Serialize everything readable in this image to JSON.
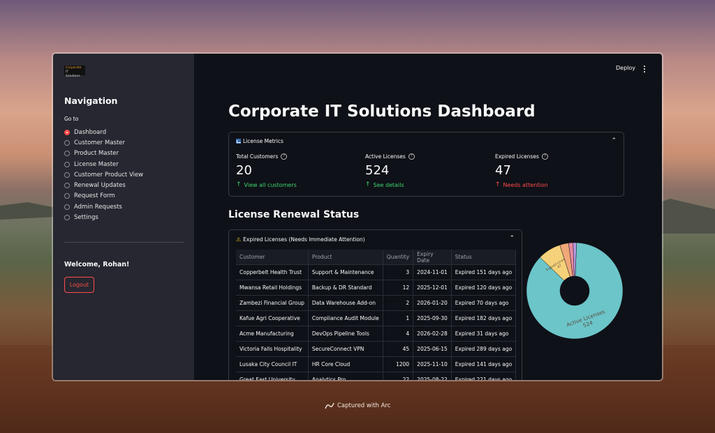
{
  "app": {
    "logo_line1": "Corporate",
    "logo_line2": "IT Solutions",
    "deploy_label": "Deploy"
  },
  "sidebar": {
    "title": "Navigation",
    "goto_label": "Go to",
    "items": [
      {
        "label": "Dashboard",
        "selected": true
      },
      {
        "label": "Customer Master",
        "selected": false
      },
      {
        "label": "Product Master",
        "selected": false
      },
      {
        "label": "License Master",
        "selected": false
      },
      {
        "label": "Customer Product View",
        "selected": false
      },
      {
        "label": "Renewal Updates",
        "selected": false
      },
      {
        "label": "Request Form",
        "selected": false
      },
      {
        "label": "Admin Requests",
        "selected": false
      },
      {
        "label": "Settings",
        "selected": false
      }
    ],
    "welcome": "Welcome, Rohan!",
    "logout_label": "Logout"
  },
  "main": {
    "title": "Corporate IT Solutions Dashboard",
    "metrics_header": "License Metrics",
    "metrics": [
      {
        "label": "Total Customers",
        "value": "20",
        "delta": "View all customers",
        "direction": "up",
        "color": "#3dd56d"
      },
      {
        "label": "Active Licenses",
        "value": "524",
        "delta": "See details",
        "direction": "up",
        "color": "#3dd56d"
      },
      {
        "label": "Expired Licenses",
        "value": "47",
        "delta": "Needs attention",
        "direction": "up",
        "color": "#ff4b4b"
      }
    ],
    "renewal_title": "License Renewal Status",
    "expired_header": "Expired Licenses (Needs Immediate Attention)",
    "table": {
      "columns": [
        "Customer",
        "Product",
        "Quantity",
        "Expiry Date",
        "Status"
      ],
      "rows": [
        [
          "Copperbelt Health Trust",
          "Support & Maintenance",
          "3",
          "2024-11-01",
          "Expired 151 days ago"
        ],
        [
          "Mwansa Retail Holdings",
          "Backup & DR Standard",
          "12",
          "2025-12-01",
          "Expired 120 days ago"
        ],
        [
          "Zambezi Financial Group",
          "Data Warehouse Add-on",
          "2",
          "2026-01-20",
          "Expired 70 days ago"
        ],
        [
          "Kafue Agri Cooperative",
          "Compliance Audit Module",
          "1",
          "2025-09-30",
          "Expired 182 days ago"
        ],
        [
          "Acme Manufacturing",
          "DevOps Pipeline Tools",
          "4",
          "2026-02-28",
          "Expired 31 days ago"
        ],
        [
          "Victoria Falls Hospitality",
          "SecureConnect VPN",
          "45",
          "2025-06-15",
          "Expired 289 days ago"
        ],
        [
          "Lusaka City Council IT",
          "HR Core Cloud",
          "1200",
          "2025-11-10",
          "Expired 141 days ago"
        ],
        [
          "Great East University",
          "Analytics Pro",
          "22",
          "2025-08-22",
          "Expired 221 days ago"
        ]
      ]
    }
  },
  "chart_data": {
    "type": "pie",
    "donut": true,
    "slices": [
      {
        "label": "Active Licenses",
        "value": 524,
        "color": "#6cc5c9",
        "label_text": "Active Licenses\n524"
      },
      {
        "label": "Expired Licenses",
        "value": 47,
        "color": "#f5d27a",
        "label_text": "Expired Licenses\n47"
      },
      {
        "label": "",
        "value": 18,
        "color": "#f0a878",
        "label_text": ""
      },
      {
        "label": "",
        "value": 9,
        "color": "#e88aa0",
        "label_text": ""
      },
      {
        "label": "",
        "value": 7,
        "color": "#b79ae0",
        "label_text": ""
      }
    ]
  },
  "footer": {
    "captured": "Captured with Arc"
  },
  "colors": {
    "accent": "#ff4b4b",
    "positive": "#3dd56d",
    "app_bg": "#0e1117",
    "sidebar_bg": "#262730"
  }
}
